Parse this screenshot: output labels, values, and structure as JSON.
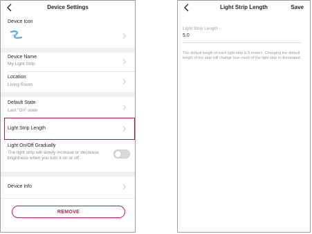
{
  "settings": {
    "title": "Device Settings",
    "device_icon_label": "Device Icon",
    "device_name": {
      "label": "Device Name",
      "value": "My Light Strip"
    },
    "location": {
      "label": "Location",
      "value": "Living Room"
    },
    "default_state": {
      "label": "Default State",
      "value": "Last \"On\" state"
    },
    "light_strip_length": {
      "label": "Light Strip Length"
    },
    "gradual": {
      "label": "Light On/Off Gradually",
      "description": "The light strip will slowly increase or decrease brightness when you turn it on or off.",
      "enabled": false
    },
    "device_info": {
      "label": "Device Info"
    },
    "remove_label": "REMOVE"
  },
  "length_screen": {
    "title": "Light Strip Length",
    "save_label": "Save",
    "field_label": "Light Strip Length",
    "field_value": "5.0",
    "note": "The default length of each light strip is 5 meters. Changing the default length of the strip will change how much of the light strip is illuminated."
  },
  "colors": {
    "accent": "#c8184b",
    "highlight": "#a41e3c",
    "icon": "#5aa7e6"
  }
}
